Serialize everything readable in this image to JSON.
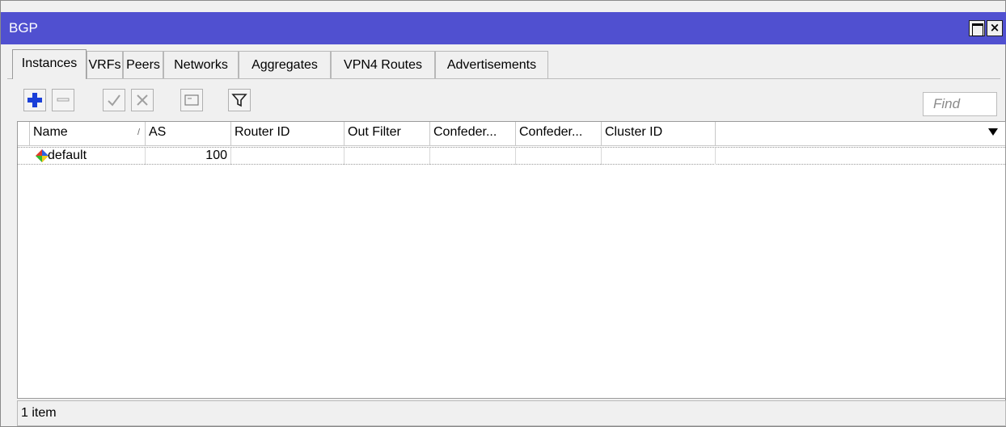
{
  "window": {
    "title": "BGP"
  },
  "tabs": [
    {
      "label": "Instances",
      "active": true
    },
    {
      "label": "VRFs"
    },
    {
      "label": "Peers"
    },
    {
      "label": "Networks"
    },
    {
      "label": "Aggregates"
    },
    {
      "label": "VPN4 Routes"
    },
    {
      "label": "Advertisements"
    }
  ],
  "toolbar": {
    "buttons": [
      "add-icon",
      "remove-icon",
      "enable-icon",
      "disable-icon",
      "comment-icon",
      "filter-icon"
    ],
    "find_placeholder": "Find"
  },
  "table": {
    "columns": [
      "Name",
      "AS",
      "Router ID",
      "Out Filter",
      "Confeder...",
      "Confeder...",
      "Cluster ID"
    ],
    "sort_indicator": "/",
    "rows": [
      {
        "name": "default",
        "as": "100",
        "router_id": "",
        "out_filter": "",
        "confed1": "",
        "confed2": "",
        "cluster_id": ""
      }
    ]
  },
  "status": {
    "text": "1 item"
  },
  "colors": {
    "titlebar": "#5050d0",
    "add_icon": "#1a3fd8"
  }
}
